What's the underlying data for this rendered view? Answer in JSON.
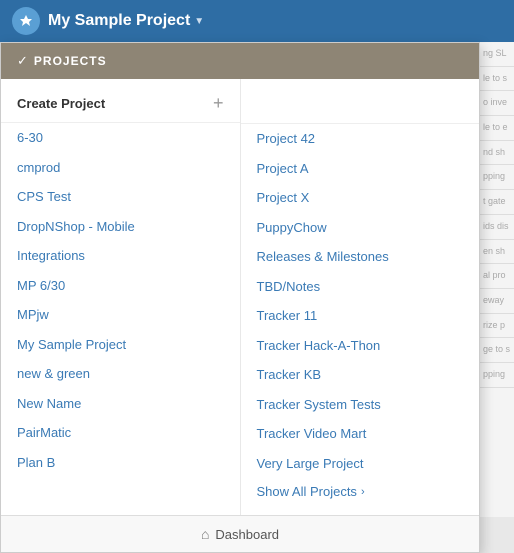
{
  "nav": {
    "project_title": "My Sample Project",
    "dropdown_arrow": "▼",
    "logo_symbol": "★"
  },
  "dropdown": {
    "header_label": "PROJECTS",
    "header_check": "✓",
    "create_label": "Create Project",
    "create_plus": "+",
    "col1": [
      {
        "label": "6-30"
      },
      {
        "label": "cmprod"
      },
      {
        "label": "CPS Test"
      },
      {
        "label": "DropNShop - Mobile"
      },
      {
        "label": "Integrations"
      },
      {
        "label": "MP 6/30"
      },
      {
        "label": "MPjw"
      },
      {
        "label": "My Sample Project"
      },
      {
        "label": "new & green"
      },
      {
        "label": "New Name"
      },
      {
        "label": "PairMatic"
      },
      {
        "label": "Plan B"
      }
    ],
    "col2": [
      {
        "label": "Project 42"
      },
      {
        "label": "Project A"
      },
      {
        "label": "Project X"
      },
      {
        "label": "PuppyChow"
      },
      {
        "label": "Releases & Milestones"
      },
      {
        "label": "TBD/Notes"
      },
      {
        "label": "Tracker 11"
      },
      {
        "label": "Tracker Hack-A-Thon"
      },
      {
        "label": "Tracker KB"
      },
      {
        "label": "Tracker System Tests"
      },
      {
        "label": "Tracker Video Mart"
      },
      {
        "label": "Very Large Project"
      }
    ],
    "show_all_label": "Show All Projects",
    "show_all_arrow": "›",
    "dashboard_icon": "⌂",
    "dashboard_label": "Dashboard"
  },
  "right_peek": {
    "lines": [
      "ng SL",
      "le to s",
      "o inve",
      "le to e",
      "nd sh",
      "pping",
      "t gatew",
      "ids dis",
      "en sh",
      "al proc",
      "eway",
      "rize p",
      "ge to s",
      "pping"
    ]
  }
}
